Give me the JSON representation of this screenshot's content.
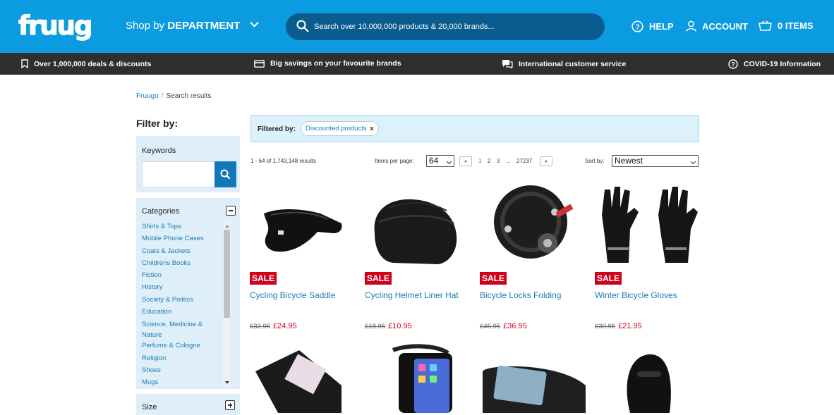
{
  "header": {
    "logo_text": "fruugo",
    "shop_by": "Shop by",
    "department": "DEPARTMENT",
    "search_placeholder": "Search over 10,000,000 products & 20,000 brands...",
    "help": "HELP",
    "account": "ACCOUNT",
    "items": "0 ITEMS"
  },
  "infobar": {
    "deals": "Over 1,000,000 deals & discounts",
    "savings": "Big savings on your favourite brands",
    "service": "International customer service",
    "covid": "COVID-19 Information"
  },
  "breadcrumb": {
    "home": "Fruugo",
    "sep": "/",
    "current": "Search results"
  },
  "sidebar": {
    "filter_by": "Filter by:",
    "keywords_label": "Keywords",
    "categories_label": "Categories",
    "categories": [
      "Shirts & Tops",
      "Mobile Phone Cases",
      "Coats & Jackets",
      "Childrens Books",
      "Fiction",
      "History",
      "Society & Politics",
      "Education",
      "Science, Medicine & Nature",
      "Perfume & Cologne",
      "Religion",
      "Shoes",
      "Mugs"
    ],
    "size_label": "Size"
  },
  "filters": {
    "label": "Filtered by:",
    "chip": "Discounted products",
    "chip_remove": "x"
  },
  "toolbar": {
    "results": "1 - 64 of 1,743,148 results",
    "items_per_page_label": "Items per page:",
    "items_per_page": "64",
    "pages": [
      "1",
      "2",
      "3",
      "...",
      "27237"
    ],
    "sort_label": "Sort by:",
    "sort_value": "Newest"
  },
  "products": [
    {
      "title": "Cycling Bicycle Saddle",
      "badge": "SALE",
      "was": "£32.95",
      "now": "£24.95",
      "icon": "saddle-image"
    },
    {
      "title": "Cycling Helmet Liner Hat",
      "badge": "SALE",
      "was": "£18.95",
      "now": "£10.95",
      "icon": "hat-image"
    },
    {
      "title": "Bicycle Locks Folding",
      "badge": "SALE",
      "was": "£45.95",
      "now": "£36.95",
      "icon": "lock-image"
    },
    {
      "title": "Winter Bicycle Gloves",
      "badge": "SALE",
      "was": "£30.95",
      "now": "£21.95",
      "icon": "gloves-image"
    }
  ],
  "colors": {
    "brand_blue": "#0b9be0",
    "dark_bar": "#2f2f2f",
    "sale_red": "#d0021b",
    "link_blue": "#1c7ab6",
    "panel_bg": "#dfeff9"
  }
}
